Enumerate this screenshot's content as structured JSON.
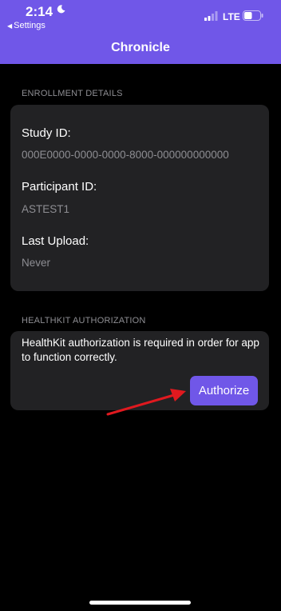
{
  "status_bar": {
    "time": "2:14",
    "back_label": "Settings",
    "carrier": "LTE",
    "moon_icon": "moon-icon",
    "signal_icon": "signal-bars-icon",
    "battery_icon": "battery-icon",
    "battery_level": 0.5
  },
  "nav": {
    "title": "Chronicle"
  },
  "enrollment": {
    "header": "ENROLLMENT DETAILS",
    "fields": [
      {
        "label": "Study ID:",
        "value": "000E0000-0000-0000-8000-000000000000"
      },
      {
        "label": "Participant ID:",
        "value": "ASTEST1"
      },
      {
        "label": "Last Upload:",
        "value": "Never"
      }
    ]
  },
  "healthkit": {
    "header": "HEALTHKIT AUTHORIZATION",
    "message": "HealthKit authorization is required in order for app to function correctly.",
    "button_label": "Authorize"
  },
  "colors": {
    "accent": "#7057e8",
    "card": "#222224",
    "secondary_text": "#8e8e93",
    "annotation_arrow": "#e0191f"
  }
}
